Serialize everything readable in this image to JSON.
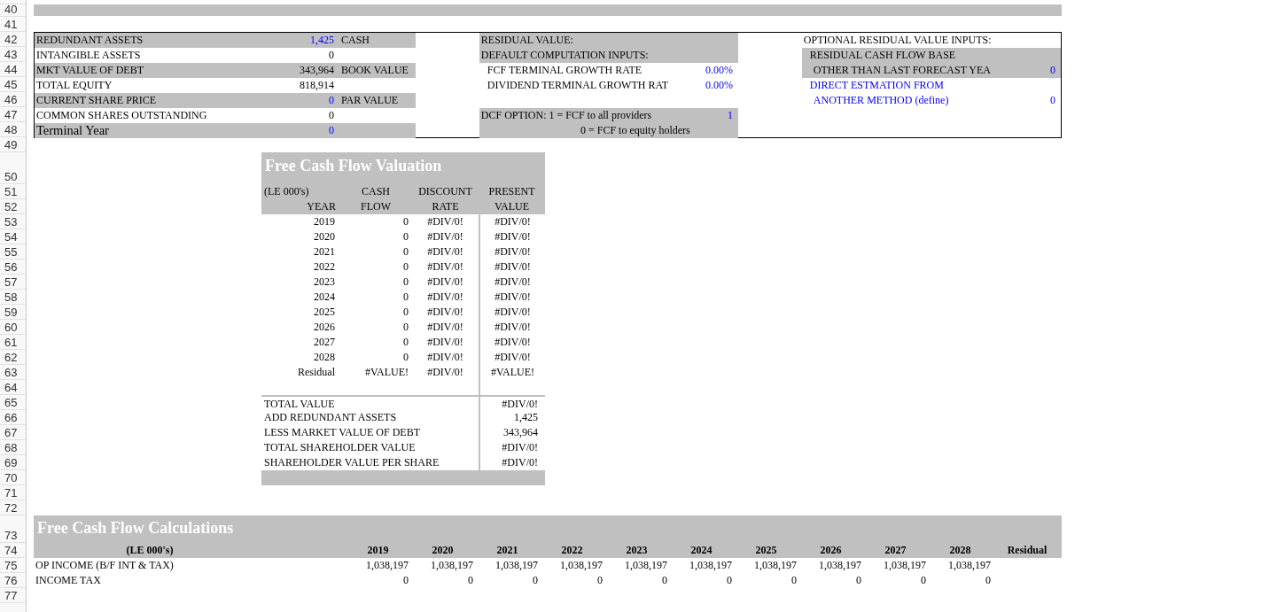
{
  "row_numbers": [
    "40",
    "41",
    "42",
    "43",
    "44",
    "45",
    "46",
    "47",
    "48",
    "49",
    "50",
    "51",
    "52",
    "53",
    "54",
    "55",
    "56",
    "57",
    "58",
    "59",
    "60",
    "61",
    "62",
    "63",
    "64",
    "65",
    "66",
    "67",
    "68",
    "69",
    "70",
    "71",
    "72",
    "73",
    "74",
    "75",
    "76",
    "77"
  ],
  "summary": {
    "left": [
      {
        "kind": "field",
        "label": "REDUNDANT ASSETS",
        "value": "1,425",
        "value_is_input": true,
        "note": "CASH",
        "shaded": true
      },
      {
        "kind": "field",
        "label": "INTANGIBLE ASSETS",
        "value": "0",
        "value_is_input": false,
        "shaded": false
      },
      {
        "kind": "field",
        "label": "MKT VALUE OF DEBT",
        "value": "343,964",
        "value_is_input": false,
        "note": "BOOK VALUE",
        "shaded": true
      },
      {
        "kind": "field",
        "label": "TOTAL EQUITY",
        "value": "818,914",
        "value_is_input": false,
        "shaded": false
      },
      {
        "kind": "field",
        "label": "CURRENT SHARE PRICE",
        "value": "0",
        "value_is_input": true,
        "note": "PAR VALUE",
        "shaded": true
      },
      {
        "kind": "field",
        "label": "COMMON SHARES OUTSTANDING",
        "value": "0",
        "value_is_input": false,
        "shaded": false
      },
      {
        "kind": "title",
        "label": "Terminal Year",
        "value": "0",
        "value_is_input": true,
        "shaded": true
      }
    ],
    "residual": [
      {
        "kind": "heading",
        "label": "RESIDUAL VALUE:",
        "shaded": true
      },
      {
        "kind": "heading",
        "label": "DEFAULT COMPUTATION INPUTS:",
        "shaded": true
      },
      {
        "kind": "item",
        "label": "FCF TERMINAL GROWTH RATE",
        "value": "0.00%",
        "value_is_input": true,
        "shaded": false
      },
      {
        "kind": "item",
        "label": "DIVIDEND TERMINAL GROWTH RAT",
        "value": "0.00%",
        "value_is_input": true,
        "shaded": false
      },
      {
        "kind": "blank"
      },
      {
        "kind": "heading",
        "label": "DCF OPTION: 1 = FCF to all providers",
        "value": "1",
        "value_is_input": true,
        "shaded": true
      },
      {
        "kind": "centered",
        "label": "0 = FCF to equity holders",
        "shaded": true
      }
    ],
    "optional": [
      {
        "kind": "heading",
        "label": "OPTIONAL RESIDUAL VALUE INPUTS:",
        "label_is_input": false,
        "shaded": false
      },
      {
        "kind": "item",
        "label": "RESIDUAL CASH FLOW BASE",
        "label_is_input": false,
        "shaded": true
      },
      {
        "kind": "subitem",
        "label": "OTHER THAN LAST FORECAST YEA",
        "label_is_input": false,
        "value": "0",
        "value_is_input": true,
        "shaded": true
      },
      {
        "kind": "item",
        "label": "DIRECT ESTMATION FROM",
        "label_is_input": true,
        "shaded": false
      },
      {
        "kind": "subitem",
        "label": "ANOTHER METHOD (define)",
        "label_is_input": true,
        "value": "0",
        "value_is_input": true,
        "shaded": false
      }
    ]
  },
  "valuation": {
    "title": "Free Cash Flow Valuation",
    "header_top": [
      "(LE 000's)",
      "CASH",
      "DISCOUNT",
      "PRESENT"
    ],
    "header_bottom": [
      "YEAR",
      "FLOW",
      "RATE",
      "VALUE"
    ],
    "rows": [
      [
        "2019",
        "0",
        "#DIV/0!",
        "#DIV/0!"
      ],
      [
        "2020",
        "0",
        "#DIV/0!",
        "#DIV/0!"
      ],
      [
        "2021",
        "0",
        "#DIV/0!",
        "#DIV/0!"
      ],
      [
        "2022",
        "0",
        "#DIV/0!",
        "#DIV/0!"
      ],
      [
        "2023",
        "0",
        "#DIV/0!",
        "#DIV/0!"
      ],
      [
        "2024",
        "0",
        "#DIV/0!",
        "#DIV/0!"
      ],
      [
        "2025",
        "0",
        "#DIV/0!",
        "#DIV/0!"
      ],
      [
        "2026",
        "0",
        "#DIV/0!",
        "#DIV/0!"
      ],
      [
        "2027",
        "0",
        "#DIV/0!",
        "#DIV/0!"
      ],
      [
        "2028",
        "0",
        "#DIV/0!",
        "#DIV/0!"
      ],
      [
        "Residual",
        "#VALUE!",
        "#DIV/0!",
        "#VALUE!"
      ]
    ],
    "totals": [
      {
        "label": "TOTAL VALUE",
        "value": "#DIV/0!"
      },
      {
        "label": "ADD REDUNDANT ASSETS",
        "value": "1,425"
      },
      {
        "label": "LESS MARKET VALUE OF DEBT",
        "value": "343,964"
      },
      {
        "label": "TOTAL SHAREHOLDER VALUE",
        "value": "#DIV/0!"
      },
      {
        "label": "SHAREHOLDER VALUE PER SHARE",
        "value": "#DIV/0!"
      }
    ]
  },
  "calculations": {
    "title": "Free Cash Flow Calculations",
    "unit": "(LE 000's)",
    "columns": [
      "2019",
      "2020",
      "2021",
      "2022",
      "2023",
      "2024",
      "2025",
      "2026",
      "2027",
      "2028",
      "Residual"
    ],
    "rows": [
      {
        "label": "OP INCOME (B/F INT & TAX)",
        "values": [
          "1,038,197",
          "1,038,197",
          "1,038,197",
          "1,038,197",
          "1,038,197",
          "1,038,197",
          "1,038,197",
          "1,038,197",
          "1,038,197",
          "1,038,197"
        ]
      },
      {
        "label": "INCOME TAX",
        "values": [
          "0",
          "0",
          "0",
          "0",
          "0",
          "0",
          "0",
          "0",
          "0",
          "0"
        ]
      }
    ]
  }
}
